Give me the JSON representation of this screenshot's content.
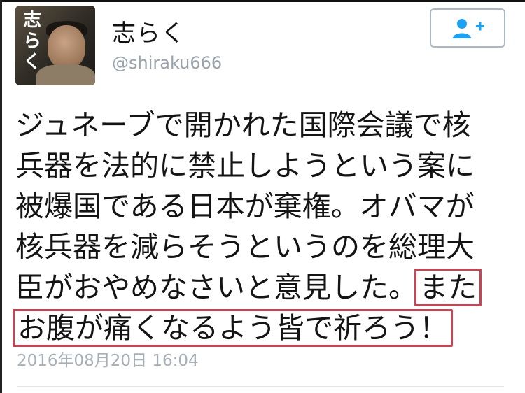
{
  "user": {
    "display_name": "志らく",
    "handle": "@shiraku666",
    "avatar_label": [
      "志",
      "ら",
      "く"
    ]
  },
  "follow_button": {
    "icon": "add-user-icon"
  },
  "tweet": {
    "lines": [
      "ジュネーブで開かれた国際会議で核",
      "兵器を法的に禁止しようという案に",
      "被爆国である日本が棄権。オバマが",
      "核兵器を減らそうというのを総理大",
      "臣がおやめなさいと意見した。",
      "お腹が痛くなるよう皆で祈ろう！"
    ],
    "highlight_start": "また",
    "timestamp": "2016年08月20日 16:04"
  },
  "colors": {
    "highlight_border": "#c44654",
    "follow_icon": "#1da1f2",
    "handle": "#9aa3ab",
    "timestamp": "#a7afb6"
  }
}
